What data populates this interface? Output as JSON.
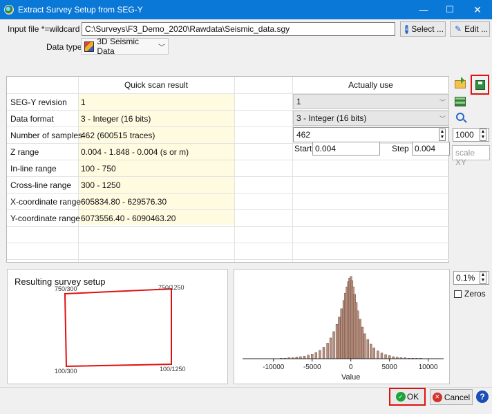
{
  "window": {
    "title": "Extract Survey Setup from SEG-Y",
    "min": "—",
    "max": "☐",
    "close": "✕"
  },
  "input": {
    "label": "Input file *=wildcard",
    "value": "C:\\Surveys\\F3_Demo_2020\\Rawdata\\Seismic_data.sgy",
    "select_label": "Select ...",
    "edit_label": "Edit ..."
  },
  "datatype": {
    "label": "Data type",
    "value": "3D Seismic Data"
  },
  "table": {
    "header_scan": "Quick scan result",
    "header_use": "Actually use",
    "rows": [
      {
        "label": "SEG-Y revision",
        "scan": "1"
      },
      {
        "label": "Data format",
        "scan": "3 - Integer (16 bits)"
      },
      {
        "label": "Number of samples",
        "scan": "462 (600515 traces)"
      },
      {
        "label": "Z range",
        "scan": "0.004 - 1.848 - 0.004 (s or m)"
      },
      {
        "label": "In-line range",
        "scan": "100 - 750"
      },
      {
        "label": "Cross-line range",
        "scan": "300 - 1250"
      },
      {
        "label": "X-coordinate range",
        "scan": "605834.80 - 629576.30"
      },
      {
        "label": "Y-coordinate range",
        "scan": "6073556.40 - 6090463.20"
      }
    ],
    "use": {
      "revision": "1",
      "format": "3 - Integer (16 bits)",
      "samples": "462",
      "start_label": "Start",
      "start_value": "0.004",
      "step_label": "Step",
      "step_value": "0.004"
    }
  },
  "side": {
    "spin_value": "1000",
    "scale_placeholder": "scale XY"
  },
  "survey": {
    "title": "Resulting survey setup",
    "corner_tl": "750/300",
    "corner_tr": "750/1250",
    "corner_bl": "100/300",
    "corner_br": "100/1250"
  },
  "histogram": {
    "clip_value": "0.1%",
    "zeros_label": "Zeros"
  },
  "chart_data": {
    "type": "bar",
    "title": "",
    "xlabel": "Value",
    "ylabel": "",
    "xlim": [
      -14000,
      12000
    ],
    "xticks": [
      -10000,
      -5000,
      0,
      5000,
      10000
    ],
    "xtick_labels": [
      "-10000",
      "-5000",
      "0",
      "5000",
      "10000"
    ],
    "bar_color": "#b78e7e",
    "x": [
      -9000,
      -8500,
      -8000,
      -7500,
      -7000,
      -6500,
      -6000,
      -5500,
      -5000,
      -4500,
      -4000,
      -3500,
      -3000,
      -2600,
      -2200,
      -1800,
      -1500,
      -1200,
      -900,
      -700,
      -500,
      -300,
      -150,
      0,
      150,
      300,
      500,
      700,
      900,
      1200,
      1500,
      1800,
      2200,
      2600,
      3000,
      3500,
      4000,
      4500,
      5000,
      5500,
      6000,
      6500,
      7000,
      7500,
      8000,
      8500,
      9000
    ],
    "values": [
      1,
      1,
      2,
      2,
      3,
      4,
      5,
      7,
      9,
      12,
      16,
      22,
      30,
      40,
      52,
      66,
      80,
      96,
      112,
      126,
      138,
      148,
      155,
      158,
      150,
      138,
      124,
      108,
      92,
      76,
      61,
      48,
      37,
      28,
      21,
      15,
      11,
      8,
      6,
      4,
      3,
      2,
      2,
      1,
      1,
      1,
      1
    ]
  },
  "buttons": {
    "ok": "OK",
    "cancel": "Cancel",
    "help": "?"
  }
}
